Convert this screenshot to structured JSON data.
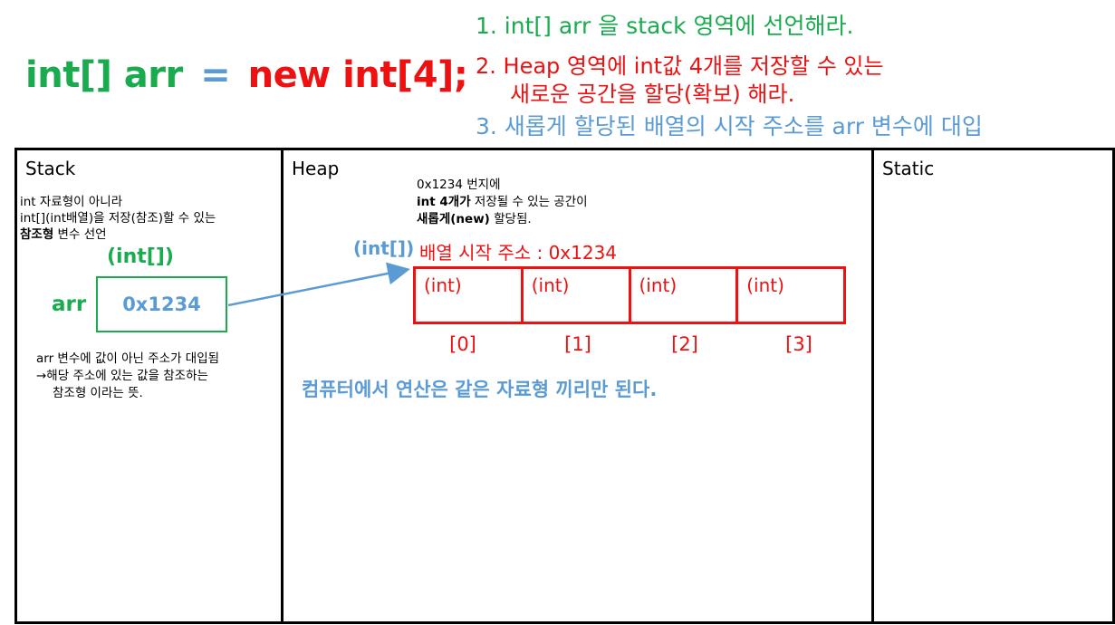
{
  "code": {
    "part1": "int[] arr",
    "part2": "=",
    "part3": "new int[4];"
  },
  "steps": [
    {
      "text": "1. int[] arr 을 stack 영역에 선언해라.",
      "color": "#1aab4f"
    },
    {
      "line1": "2.   Heap 영역에 int값 4개를 저장할 수 있는",
      "line2": "새로운 공간을 할당(확보) 해라.",
      "color": "#ee1111"
    },
    {
      "text": "3. 새롭게 할당된 배열의 시작 주소를 arr 변수에 대입",
      "color": "#5b9bd5"
    }
  ],
  "stack": {
    "title": "Stack",
    "note1": "int 자료형이 아니라",
    "note2": "int[](int배열)을 저장(참조)할 수 있는",
    "note3_bold": "참조형",
    "note3_rest": " 변수 선언",
    "type_label": "(int[])",
    "var_name": "arr",
    "var_value": "0x1234",
    "note4": "arr 변수에 값이 아닌 주소가 대입됨",
    "note5": "→해당 주소에 있는 값을 참조하는",
    "note6": "참조형 이라는 뜻."
  },
  "heap": {
    "title": "Heap",
    "note1": "0x1234 번지에",
    "note2_bold": "int 4개가",
    "note2_rest": " 저장될 수 있는 공간이",
    "note3_bold": "새롭게(new)",
    "note3_rest": " 할당됨.",
    "type_label": "(int[])",
    "start_address_label": "배열 시작 주소 : 0x1234",
    "cells": [
      "(int)",
      "(int)",
      "(int)",
      "(int)"
    ],
    "indices": [
      "[0]",
      "[1]",
      "[2]",
      "[3]"
    ],
    "footer": "컴퓨터에서 연산은 같은 자료형 끼리만 된다."
  },
  "static": {
    "title": "Static"
  },
  "colors": {
    "green": "#1aab4f",
    "red": "#ee1111",
    "blue": "#5b9bd5"
  }
}
